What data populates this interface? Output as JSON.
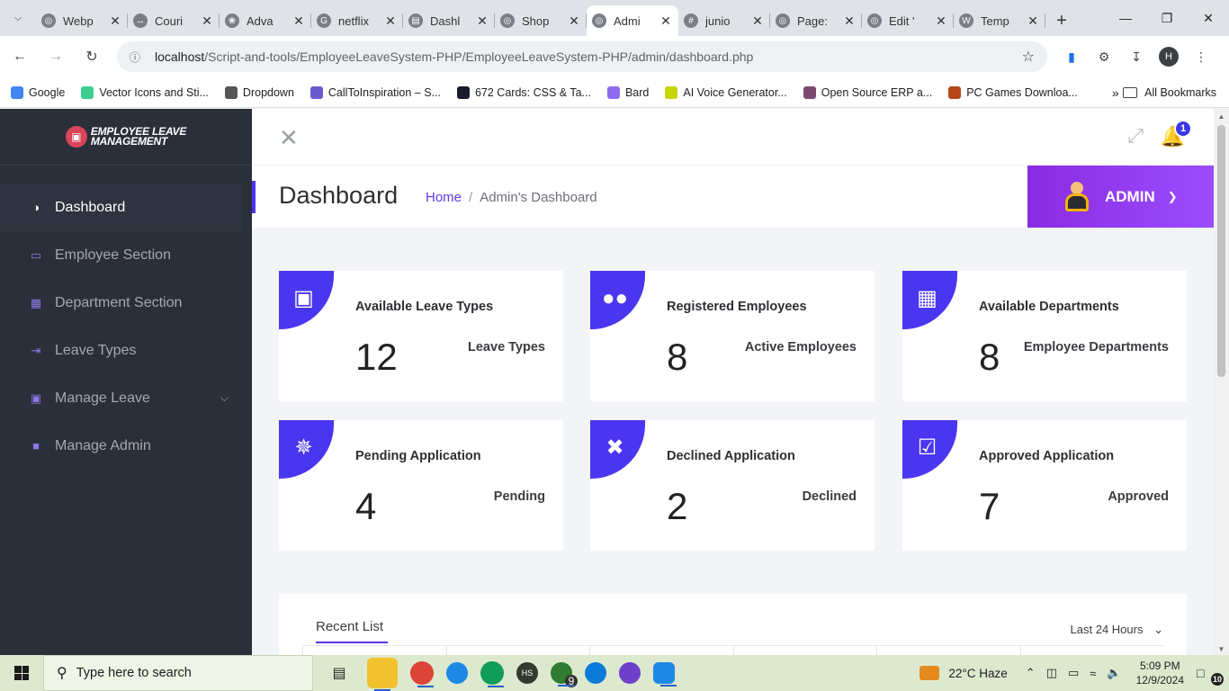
{
  "browser": {
    "tabs": [
      {
        "title": "Webp",
        "icon": "globe-icon",
        "active": false
      },
      {
        "title": "Couri",
        "icon": "link-icon",
        "active": false
      },
      {
        "title": "Adva",
        "icon": "openai-icon",
        "active": false
      },
      {
        "title": "netflix",
        "icon": "google-icon",
        "active": false
      },
      {
        "title": "Dashl",
        "icon": "dashboard-icon",
        "active": false
      },
      {
        "title": "Shop",
        "icon": "globe-icon",
        "active": false
      },
      {
        "title": "Admi",
        "icon": "globe-icon",
        "active": true
      },
      {
        "title": "junio",
        "icon": "slack-icon",
        "active": false
      },
      {
        "title": "Page:",
        "icon": "globe-icon",
        "active": false
      },
      {
        "title": "Edit '",
        "icon": "globe-icon",
        "active": false
      },
      {
        "title": "Temp",
        "icon": "wordpress-icon",
        "active": false
      }
    ],
    "url_host": "localhost",
    "url_path": "/Script-and-tools/EmployeeLeaveSystem-PHP/EmployeeLeaveSystem-PHP/admin/dashboard.php",
    "profile_initial": "H",
    "bookmarks": [
      {
        "label": "Google",
        "color": "#4285f4"
      },
      {
        "label": "Vector Icons and Sti...",
        "color": "#3ecf8e"
      },
      {
        "label": "Dropdown",
        "color": "#555555"
      },
      {
        "label": "CallToInspiration – S...",
        "color": "#6a5acd"
      },
      {
        "label": "672 Cards: CSS & Ta...",
        "color": "#1a1a2e"
      },
      {
        "label": "Bard",
        "color": "#8e6cf0"
      },
      {
        "label": "AI Voice Generator...",
        "color": "#c6d600"
      },
      {
        "label": "Open Source ERP a...",
        "color": "#7c4a6e"
      },
      {
        "label": "PC Games Downloa...",
        "color": "#b5471b"
      }
    ],
    "all_bookmarks": "All Bookmarks"
  },
  "sidebar": {
    "logo_line1": "Employee Leave",
    "logo_line2": "Management",
    "items": [
      {
        "label": "Dashboard",
        "icon": "speedometer-icon",
        "active": true,
        "chevron": false
      },
      {
        "label": "Employee Section",
        "icon": "id-card-icon",
        "active": false,
        "chevron": false
      },
      {
        "label": "Department Section",
        "icon": "grid-icon",
        "active": false,
        "chevron": false
      },
      {
        "label": "Leave Types",
        "icon": "sign-out-icon",
        "active": false,
        "chevron": false
      },
      {
        "label": "Manage Leave",
        "icon": "briefcase-icon",
        "active": false,
        "chevron": true
      },
      {
        "label": "Manage Admin",
        "icon": "lock-icon",
        "active": false,
        "chevron": false
      }
    ]
  },
  "topbar": {
    "notification_count": "1"
  },
  "header": {
    "title": "Dashboard",
    "breadcrumb_home": "Home",
    "breadcrumb_sep": "/",
    "breadcrumb_current": "Admin's Dashboard",
    "user_label": "ADMIN"
  },
  "cards": [
    {
      "title": "Available Leave Types",
      "value": "12",
      "sub": "Leave Types",
      "icon": "toolbox-icon"
    },
    {
      "title": "Registered Employees",
      "value": "8",
      "sub": "Active Employees",
      "icon": "users-icon"
    },
    {
      "title": "Available Departments",
      "value": "8",
      "sub": "Employee Departments",
      "icon": "grid-icon"
    },
    {
      "title": "Pending Application",
      "value": "4",
      "sub": "Pending",
      "icon": "spinner-icon"
    },
    {
      "title": "Declined Application",
      "value": "2",
      "sub": "Declined",
      "icon": "times-icon"
    },
    {
      "title": "Approved Application",
      "value": "7",
      "sub": "Approved",
      "icon": "check-square-icon"
    }
  ],
  "recent": {
    "title": "Recent List",
    "filter": "Last 24 Hours"
  },
  "taskbar": {
    "search_placeholder": "Type here to search",
    "weather": "22°C  Haze",
    "time": "5:09 PM",
    "date": "12/9/2024",
    "notification_count": "10",
    "whatsapp_badge": "9"
  },
  "colors": {
    "accent": "#4a36f0",
    "sidebar_bg": "#2b2f3a",
    "admin_gradient_start": "#8a2be2",
    "admin_gradient_end": "#9b4dff"
  }
}
